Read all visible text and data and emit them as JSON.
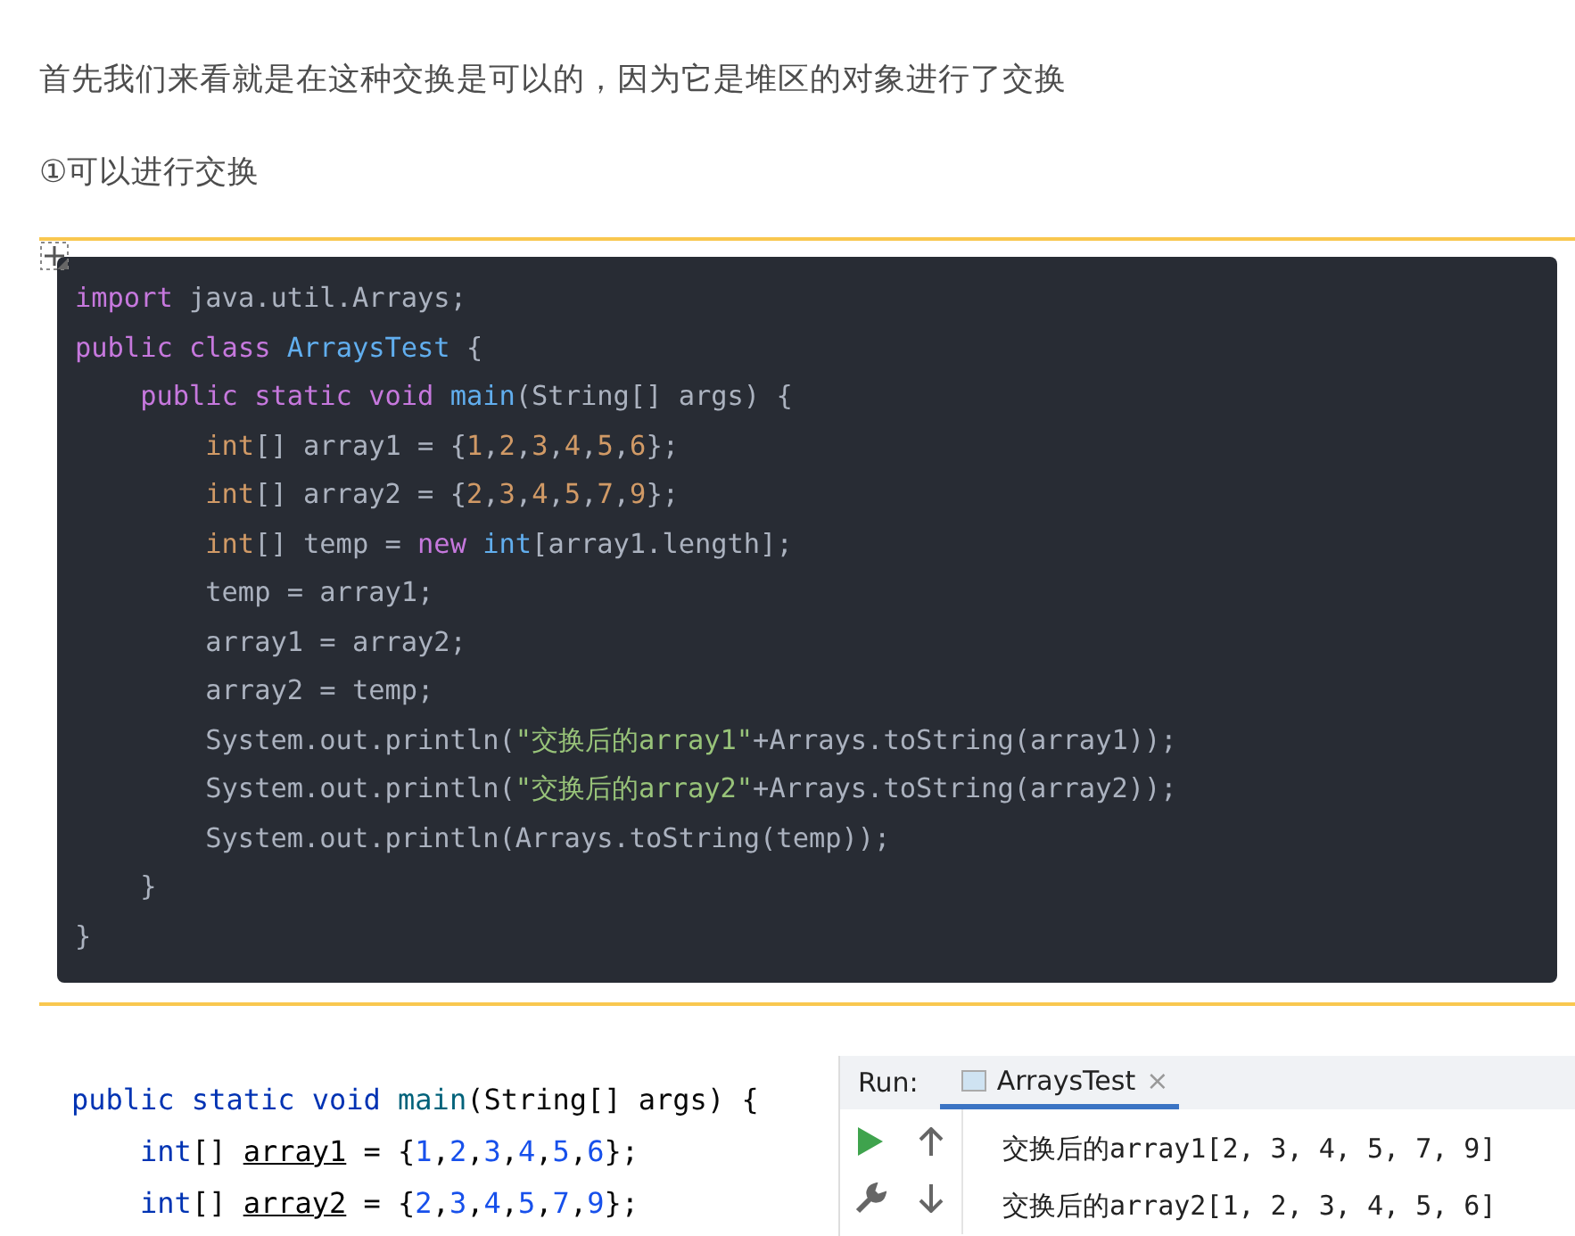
{
  "paragraphs": [
    "首先我们来看就是在这种交换是可以的，因为它是堆区的对象进行了交换",
    "①可以进行交换"
  ],
  "code_block": {
    "lines": [
      [
        {
          "kind": "kw",
          "text": "import"
        },
        {
          "kind": "plain",
          "text": " java.util.Arrays;"
        }
      ],
      [
        {
          "kind": "kw",
          "text": "public"
        },
        {
          "kind": "kw",
          "text": " class"
        },
        {
          "kind": "title",
          "text": " ArraysTest"
        },
        {
          "kind": "plain",
          "text": " {"
        }
      ],
      [
        {
          "kind": "kw",
          "text": "    public"
        },
        {
          "kind": "kw",
          "text": " static"
        },
        {
          "kind": "kw",
          "text": " void"
        },
        {
          "kind": "title",
          "text": " main"
        },
        {
          "kind": "plain",
          "text": "(String[] args) {"
        }
      ],
      [
        {
          "kind": "type",
          "text": "        int"
        },
        {
          "kind": "plain",
          "text": "[] array1 = {"
        },
        {
          "kind": "num",
          "text": "1"
        },
        {
          "kind": "plain",
          "text": ","
        },
        {
          "kind": "num",
          "text": "2"
        },
        {
          "kind": "plain",
          "text": ","
        },
        {
          "kind": "num",
          "text": "3"
        },
        {
          "kind": "plain",
          "text": ","
        },
        {
          "kind": "num",
          "text": "4"
        },
        {
          "kind": "plain",
          "text": ","
        },
        {
          "kind": "num",
          "text": "5"
        },
        {
          "kind": "plain",
          "text": ","
        },
        {
          "kind": "num",
          "text": "6"
        },
        {
          "kind": "plain",
          "text": "};"
        }
      ],
      [
        {
          "kind": "type",
          "text": "        int"
        },
        {
          "kind": "plain",
          "text": "[] array2 = {"
        },
        {
          "kind": "num",
          "text": "2"
        },
        {
          "kind": "plain",
          "text": ","
        },
        {
          "kind": "num",
          "text": "3"
        },
        {
          "kind": "plain",
          "text": ","
        },
        {
          "kind": "num",
          "text": "4"
        },
        {
          "kind": "plain",
          "text": ","
        },
        {
          "kind": "num",
          "text": "5"
        },
        {
          "kind": "plain",
          "text": ","
        },
        {
          "kind": "num",
          "text": "7"
        },
        {
          "kind": "plain",
          "text": ","
        },
        {
          "kind": "num",
          "text": "9"
        },
        {
          "kind": "plain",
          "text": "};"
        }
      ],
      [
        {
          "kind": "type",
          "text": "        int"
        },
        {
          "kind": "plain",
          "text": "[] temp ="
        },
        {
          "kind": "kw",
          "text": " new"
        },
        {
          "kind": "title",
          "text": " int"
        },
        {
          "kind": "plain",
          "text": "[array1.length];"
        }
      ],
      [
        {
          "kind": "plain",
          "text": "        temp = array1;"
        }
      ],
      [
        {
          "kind": "plain",
          "text": "        array1 = array2;"
        }
      ],
      [
        {
          "kind": "plain",
          "text": "        array2 = temp;"
        }
      ],
      [
        {
          "kind": "plain",
          "text": "        System.out.println("
        },
        {
          "kind": "str",
          "text": "\"交换后的array1\""
        },
        {
          "kind": "plain",
          "text": "+Arrays.toString(array1));"
        }
      ],
      [
        {
          "kind": "plain",
          "text": "        System.out.println("
        },
        {
          "kind": "str",
          "text": "\"交换后的array2\""
        },
        {
          "kind": "plain",
          "text": "+Arrays.toString(array2));"
        }
      ],
      [
        {
          "kind": "plain",
          "text": "        System.out.println(Arrays.toString(temp));"
        }
      ],
      [
        {
          "kind": "plain",
          "text": "    }"
        }
      ],
      [
        {
          "kind": "plain",
          "text": "}"
        }
      ]
    ]
  },
  "editor_screenshot": {
    "lines": [
      [
        {
          "kind": "kw",
          "text": "public"
        },
        {
          "kind": "kw",
          "text": " static"
        },
        {
          "kind": "kw",
          "text": " void"
        },
        {
          "kind": "fn",
          "text": " main"
        },
        {
          "kind": "plain",
          "text": "(String[] args) {"
        }
      ],
      [
        {
          "kind": "kw",
          "text": "    int"
        },
        {
          "kind": "plain",
          "text": "[] "
        },
        {
          "kind": "var",
          "text": "array1"
        },
        {
          "kind": "plain",
          "text": " = {"
        },
        {
          "kind": "num",
          "text": "1"
        },
        {
          "kind": "plain",
          "text": ","
        },
        {
          "kind": "num",
          "text": "2"
        },
        {
          "kind": "plain",
          "text": ","
        },
        {
          "kind": "num",
          "text": "3"
        },
        {
          "kind": "plain",
          "text": ","
        },
        {
          "kind": "num",
          "text": "4"
        },
        {
          "kind": "plain",
          "text": ","
        },
        {
          "kind": "num",
          "text": "5"
        },
        {
          "kind": "plain",
          "text": ","
        },
        {
          "kind": "num",
          "text": "6"
        },
        {
          "kind": "plain",
          "text": "};"
        }
      ],
      [
        {
          "kind": "kw",
          "text": "    int"
        },
        {
          "kind": "plain",
          "text": "[] "
        },
        {
          "kind": "var",
          "text": "array2"
        },
        {
          "kind": "plain",
          "text": " = {"
        },
        {
          "kind": "num",
          "text": "2"
        },
        {
          "kind": "plain",
          "text": ","
        },
        {
          "kind": "num",
          "text": "3"
        },
        {
          "kind": "plain",
          "text": ","
        },
        {
          "kind": "num",
          "text": "4"
        },
        {
          "kind": "plain",
          "text": ","
        },
        {
          "kind": "num",
          "text": "5"
        },
        {
          "kind": "plain",
          "text": ","
        },
        {
          "kind": "num",
          "text": "7"
        },
        {
          "kind": "plain",
          "text": ","
        },
        {
          "kind": "num",
          "text": "9"
        },
        {
          "kind": "plain",
          "text": "};"
        }
      ]
    ]
  },
  "run_panel": {
    "label": "Run:",
    "tabs": [
      {
        "label": "ArraysTest",
        "close": "×",
        "selected": true
      }
    ],
    "output": [
      "交换后的array1[2, 3, 4, 5, 7, 9]",
      "交换后的array2[1, 2, 3, 4, 5, 6]"
    ]
  }
}
